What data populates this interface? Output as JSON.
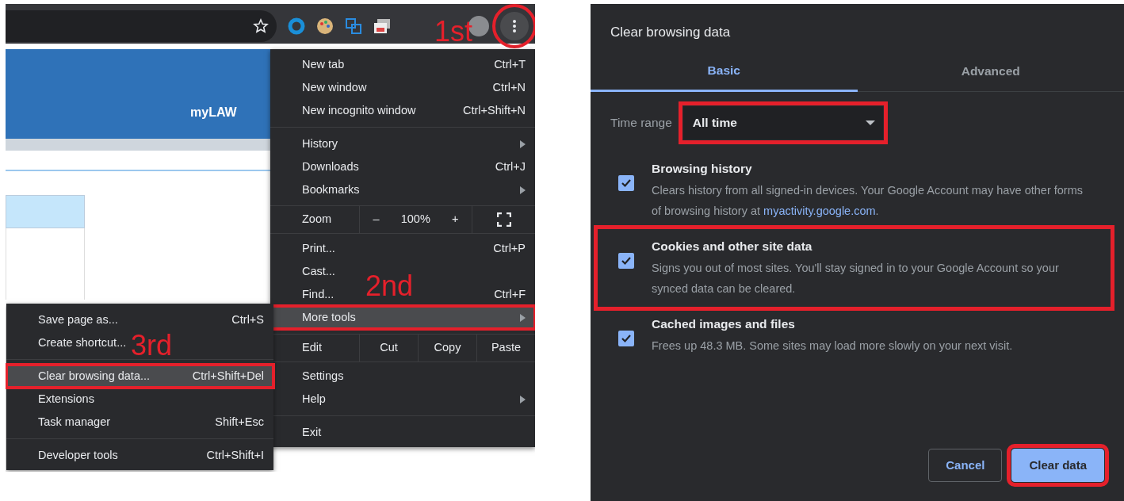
{
  "browser": {
    "banner_text": "myLAW",
    "menu": [
      {
        "kind": "item",
        "label": "New tab",
        "shortcut": "Ctrl+T",
        "has_submenu": false,
        "highlighted": false
      },
      {
        "kind": "item",
        "label": "New window",
        "shortcut": "Ctrl+N",
        "has_submenu": false,
        "highlighted": false
      },
      {
        "kind": "item",
        "label": "New incognito window",
        "shortcut": "Ctrl+Shift+N",
        "has_submenu": false,
        "highlighted": false
      },
      {
        "kind": "separator"
      },
      {
        "kind": "item",
        "label": "History",
        "has_submenu": true,
        "highlighted": false
      },
      {
        "kind": "item",
        "label": "Downloads",
        "shortcut": "Ctrl+J",
        "has_submenu": false,
        "highlighted": false
      },
      {
        "kind": "item",
        "label": "Bookmarks",
        "has_submenu": true,
        "highlighted": false
      },
      {
        "kind": "zoom",
        "label": "Zoom",
        "minus": "–",
        "value": "100%",
        "plus": "+"
      },
      {
        "kind": "item",
        "label": "Print...",
        "shortcut": "Ctrl+P",
        "has_submenu": false,
        "highlighted": false
      },
      {
        "kind": "item",
        "label": "Cast...",
        "has_submenu": false,
        "highlighted": false
      },
      {
        "kind": "item",
        "label": "Find...",
        "shortcut": "Ctrl+F",
        "has_submenu": false,
        "highlighted": false
      },
      {
        "kind": "item",
        "label": "More tools",
        "has_submenu": true,
        "highlighted": true
      },
      {
        "kind": "edit",
        "label": "Edit",
        "actions": [
          "Cut",
          "Copy",
          "Paste"
        ]
      },
      {
        "kind": "item",
        "label": "Settings",
        "has_submenu": false,
        "highlighted": false
      },
      {
        "kind": "item",
        "label": "Help",
        "has_submenu": true,
        "highlighted": false
      },
      {
        "kind": "separator"
      },
      {
        "kind": "item",
        "label": "Exit",
        "has_submenu": false,
        "highlighted": false
      }
    ],
    "submenu": [
      {
        "kind": "item",
        "label": "Save page as...",
        "shortcut": "Ctrl+S",
        "highlighted": false
      },
      {
        "kind": "item",
        "label": "Create shortcut...",
        "highlighted": false
      },
      {
        "kind": "separator"
      },
      {
        "kind": "item",
        "label": "Clear browsing data...",
        "shortcut": "Ctrl+Shift+Del",
        "highlighted": true
      },
      {
        "kind": "item",
        "label": "Extensions",
        "highlighted": false
      },
      {
        "kind": "item",
        "label": "Task manager",
        "shortcut": "Shift+Esc",
        "highlighted": false
      },
      {
        "kind": "separator"
      },
      {
        "kind": "item",
        "label": "Developer tools",
        "shortcut": "Ctrl+Shift+I",
        "highlighted": false
      }
    ],
    "annotations": [
      {
        "label": "1st"
      },
      {
        "label": "2nd"
      },
      {
        "label": "3rd"
      }
    ]
  },
  "dialog": {
    "title": "Clear browsing data",
    "tabs": [
      {
        "label": "Basic",
        "selected": true
      },
      {
        "label": "Advanced",
        "selected": false
      }
    ],
    "time_range": {
      "label": "Time range",
      "value": "All time",
      "marked": true
    },
    "options": [
      {
        "title": "Browsing history",
        "description": "Clears history from all signed-in devices. Your Google Account may have other forms of browsing history at",
        "link": "myactivity.google.com",
        "after": ".",
        "checked": true,
        "marked": false
      },
      {
        "title": "Cookies and other site data",
        "description": "Signs you out of most sites. You'll stay signed in to your Google Account so your synced data can be cleared.",
        "checked": true,
        "marked": true
      },
      {
        "title": "Cached images and files",
        "description": "Frees up 48.3 MB. Some sites may load more slowly on your next visit.",
        "checked": true,
        "marked": false
      }
    ],
    "buttons": [
      {
        "label": "Cancel",
        "kind": "secondary",
        "marked": false
      },
      {
        "label": "Clear data",
        "kind": "primary",
        "marked": true
      }
    ]
  }
}
